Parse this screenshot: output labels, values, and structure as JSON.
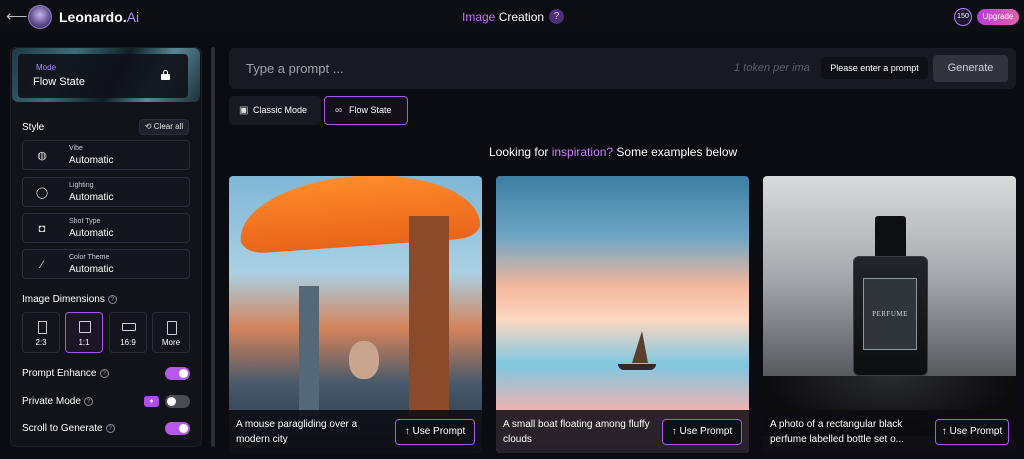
{
  "header": {
    "brand": "Leonardo.",
    "brand_suffix": "Ai",
    "title_highlight": "Image",
    "title_rest": " Creation",
    "help": "?",
    "tokens": "150",
    "upgrade": "Upgrade"
  },
  "sidebar": {
    "mode_label": "Mode",
    "mode_value": "Flow State",
    "style_title": "Style",
    "clear_all": "Clear all",
    "style_rows": [
      {
        "label": "Vibe",
        "value": "Automatic",
        "icon": "palette-icon"
      },
      {
        "label": "Lighting",
        "value": "Automatic",
        "icon": "lightbulb-icon"
      },
      {
        "label": "Shot Type",
        "value": "Automatic",
        "icon": "camera-icon"
      },
      {
        "label": "Color Theme",
        "value": "Automatic",
        "icon": "eyedropper-icon"
      }
    ],
    "dimensions_title": "Image Dimensions",
    "dimensions": [
      "2:3",
      "1:1",
      "16:9",
      "More"
    ],
    "selected_dimension": "1:1",
    "prompt_enhance": "Prompt Enhance",
    "private_mode": "Private Mode",
    "scroll_generate": "Scroll to Generate",
    "toggles": {
      "prompt_enhance": true,
      "private_mode": false,
      "scroll_generate": true
    }
  },
  "prompt": {
    "placeholder": "Type a prompt ...",
    "token_hint": "1 token per ima",
    "tooltip": "Please enter a prompt",
    "generate": "Generate"
  },
  "tabs": {
    "classic": "Classic Mode",
    "flow": "Flow State"
  },
  "inspiration": {
    "pre": "Looking for ",
    "highlight": "inspiration?",
    "post": " Some examples below"
  },
  "cards": [
    {
      "caption": "A mouse paragliding over a modern city",
      "button": "↑ Use Prompt"
    },
    {
      "caption": "A small boat floating among fluffy clouds",
      "button": "↑ Use Prompt"
    },
    {
      "caption": "A photo of a rectangular black perfume labelled bottle set o...",
      "button": "↑ Use Prompt",
      "bottle_text": "PERFUME"
    }
  ],
  "colors": {
    "accent": "#a857e8",
    "background": "#0b0c12",
    "panel": "#121319"
  }
}
